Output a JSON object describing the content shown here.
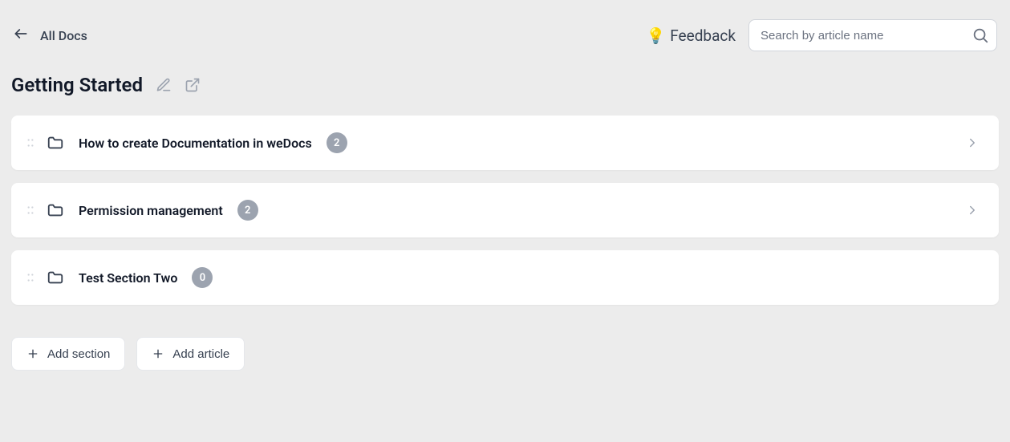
{
  "header": {
    "back_label": "All Docs",
    "feedback_label": "Feedback",
    "search_placeholder": "Search by article name"
  },
  "page": {
    "title": "Getting Started"
  },
  "sections": [
    {
      "title": "How to create Documentation in weDocs",
      "count": "2",
      "has_chevron": true
    },
    {
      "title": "Permission management",
      "count": "2",
      "has_chevron": true
    },
    {
      "title": "Test Section Two",
      "count": "0",
      "has_chevron": false
    }
  ],
  "actions": {
    "add_section": "Add section",
    "add_article": "Add article"
  }
}
